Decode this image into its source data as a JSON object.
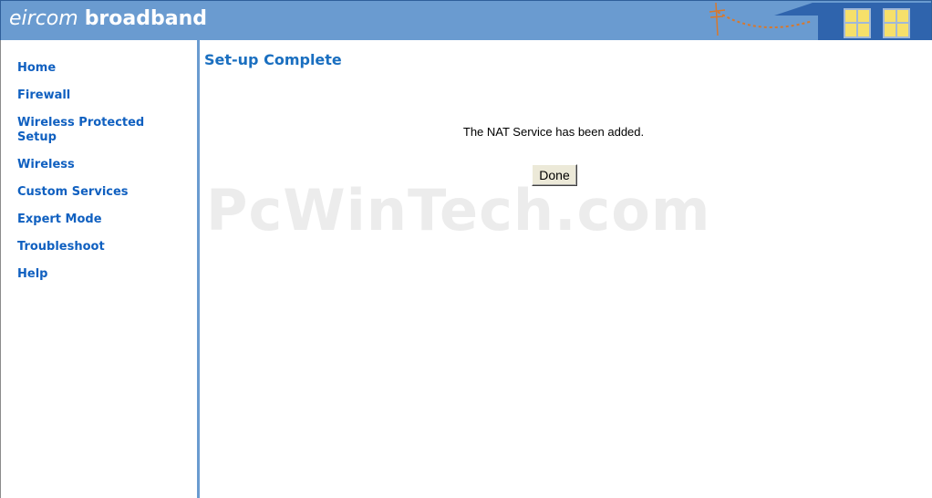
{
  "header": {
    "logo_part1": "eircom",
    "logo_part2": "broadband"
  },
  "sidebar": {
    "items": [
      {
        "label": "Home"
      },
      {
        "label": "Firewall"
      },
      {
        "label": "Wireless Protected"
      },
      {
        "label": "Setup"
      },
      {
        "label": "Wireless"
      },
      {
        "label": "Custom Services"
      },
      {
        "label": "Expert Mode"
      },
      {
        "label": "Troubleshoot"
      },
      {
        "label": "Help"
      }
    ]
  },
  "main": {
    "title": "Set-up Complete",
    "message": "The NAT Service has been added.",
    "done_label": "Done",
    "watermark": "PcWinTech.com"
  },
  "colors": {
    "header_bg": "#6a9bd0",
    "link": "#1060c0",
    "title": "#1a6fc0",
    "house": "#2f64ad",
    "window": "#f6e06a",
    "dotted_line": "#d8782c"
  }
}
